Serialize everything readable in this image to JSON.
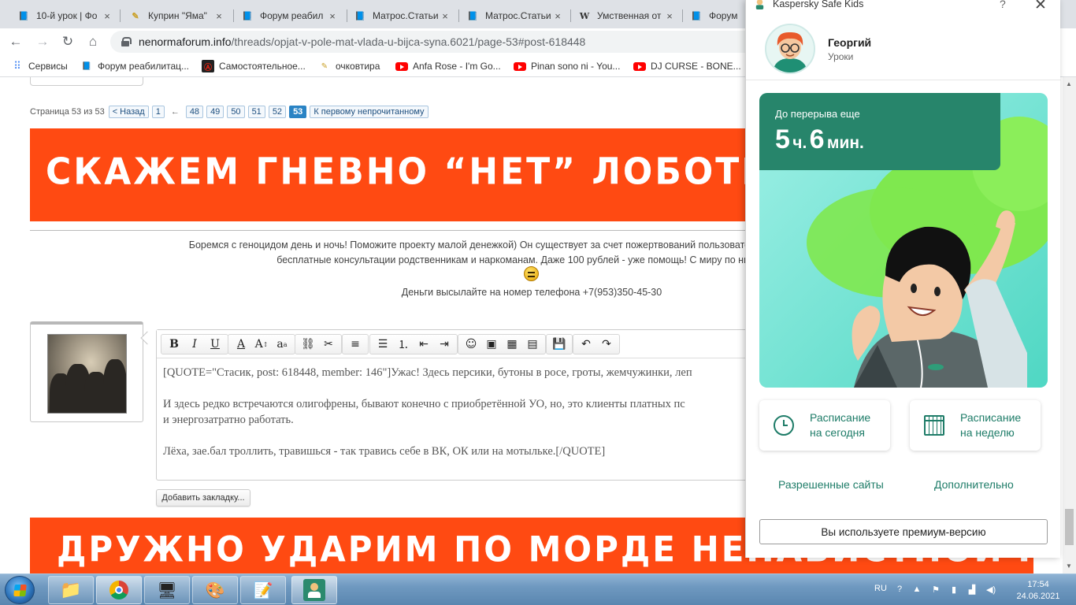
{
  "browser": {
    "tabs": [
      {
        "title": "10-й урок | Фо",
        "icon": "forum-book-icon"
      },
      {
        "title": "Куприн \"Яма\"",
        "icon": "pencil-icon"
      },
      {
        "title": "Форум реабил",
        "icon": "forum-book-icon"
      },
      {
        "title": "Матрос.Статьи",
        "icon": "forum-book-icon"
      },
      {
        "title": "Матрос.Статьи",
        "icon": "forum-book-icon"
      },
      {
        "title": "Умственная от",
        "icon": "wikipedia-icon"
      },
      {
        "title": "Форум р",
        "icon": "forum-book-icon"
      }
    ],
    "url_host": "nenormaforum.info",
    "url_path": "/threads/opjat-v-pole-mat-vlada-u-bijca-syna.6021/page-53#post-618448",
    "bookmarks": [
      {
        "label": "Сервисы",
        "icon": "apps-grid-icon"
      },
      {
        "label": "Форум реабилитац...",
        "icon": "forum-book-icon"
      },
      {
        "label": "Самостоятельное...",
        "icon": "anarchy-icon"
      },
      {
        "label": "очковтира",
        "icon": "pencil-icon"
      },
      {
        "label": "Anfa Rose - I'm Go...",
        "icon": "youtube-icon"
      },
      {
        "label": "Pinan sono ni - You...",
        "icon": "youtube-icon"
      },
      {
        "label": "DJ CURSE - BONE...",
        "icon": "youtube-icon"
      }
    ]
  },
  "page": {
    "pagination": {
      "label": "Страница 53 из 53",
      "prev": "< Назад",
      "first": "1",
      "ellipsis": "←",
      "pages": [
        "48",
        "49",
        "50",
        "51",
        "52",
        "53"
      ],
      "current": "53",
      "first_unread": "К первому непрочитанному"
    },
    "banner_top": "СКАЖЕМ ГНЕВНО “НЕТ” ЛОБОТРЯСАМ И",
    "donate_line1": "Боремся с геноцидом день и ночь! Поможите проекту малой денежкой) Он существует за счет пожертвований пользователей. Если мы не будем пол",
    "donate_line2": "бесплатные консультации родственникам и наркоманам. Даже 100 рублей - уже помощь! С миру по нитке и мо",
    "phone_line": "Деньги высылайте на номер телефона +7(953)350-45-30",
    "editor": {
      "p1": "[QUOTE=\"Стасик, post: 618448, member: 146\"]Ужас! Здесь персики, бутоны в росе, гроты, жемчужинки, леп",
      "p2a": "И здесь редко встречаются олигофрены, бывают конечно с приобретённой УО, но, это клиенты платных пс",
      "p2b": "и энергозатратно работать.",
      "p3": "Лёха, зае.бал троллить, травишься - так травись себе в ВК, ОК или на мотыльке.[/QUOTE]"
    },
    "bookmark_button": "Добавить закладку...",
    "banner_bottom": "ДРУЖНО УДАРИМ ПО МОРДЕ НЕНАВИСТНОЙ НАРКОМАНИИ!"
  },
  "kaspersky": {
    "title": "Kaspersky Safe Kids",
    "help": "?",
    "close": "✕",
    "user_name": "Георгий",
    "user_mode": "Уроки",
    "timer_label": "До перерыва еще",
    "timer_hours": "5",
    "timer_hours_unit": "ч.",
    "timer_minutes": "6",
    "timer_minutes_unit": "мин.",
    "btn_today_1": "Расписание",
    "btn_today_2": "на сегодня",
    "btn_week_1": "Расписание",
    "btn_week_2": "на неделю",
    "link_sites": "Разрешенные сайты",
    "link_more": "Дополнительно",
    "premium": "Вы используете премиум-версию",
    "accent_color": "#27856b"
  },
  "taskbar": {
    "lang": "RU",
    "time": "17:54",
    "date": "24.06.2021"
  }
}
